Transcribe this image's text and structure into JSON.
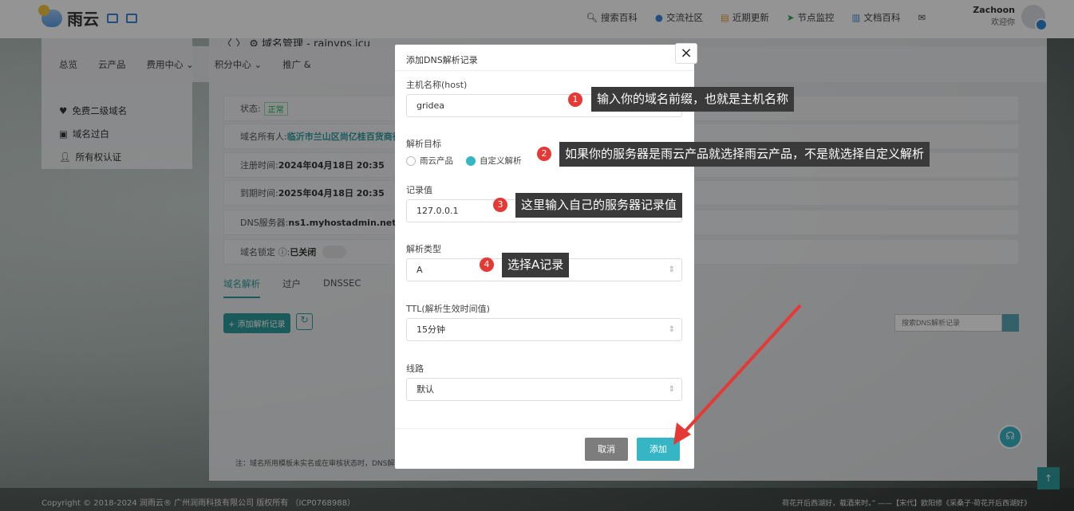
{
  "brand": {
    "name": "雨云"
  },
  "nav": [
    {
      "label": "搜索百科",
      "icon": "search-icon"
    },
    {
      "label": "交流社区",
      "icon": "community-icon"
    },
    {
      "label": "近期更新",
      "icon": "news-icon"
    },
    {
      "label": "节点监控",
      "icon": "monitor-icon"
    },
    {
      "label": "文档百科",
      "icon": "docs-icon"
    }
  ],
  "user": {
    "name": "Zachoon",
    "greeting": "欢迎你"
  },
  "menu": [
    "总览",
    "云产品",
    "费用中心 ⌄",
    "积分中心 ⌄",
    "推广 &"
  ],
  "sidebar": [
    "免费二级域名",
    "域名过白",
    "所有权认证"
  ],
  "page": {
    "title": "〈 〉 ⚙ 域名管理 - rainyps.icu"
  },
  "details": {
    "status_label": "状态:",
    "status_value": "正常",
    "owner_label": "域名所有人:",
    "owner_value": "临沂市兰山区尚亿桂百货商行",
    "reg_label": "注册时间:",
    "reg_value": "2024年04月18日 20:35",
    "exp_label": "到期时间:",
    "exp_value": "2025年04月18日 20:35",
    "dns_label": "DNS服务器:",
    "dns_value": "ns1.myhostadmin.net, n",
    "lock_label": "域名锁定 ⓘ:",
    "lock_value": "已关闭"
  },
  "tabs": [
    "域名解析",
    "过户",
    "DNSSEC"
  ],
  "actions": {
    "add_record": "+ 添加解析记录",
    "search_placeholder": "搜索DNS解析记录"
  },
  "note": "注：域名所用模板未实名或在审核状态时，DNS解",
  "footer": {
    "copyright": "Copyright © 2018-2024 润雨云® 广州润雨科技有限公司 版权所有 （ICP0768988）",
    "quote": "荷花开后西湖好，载酒来时。” ——【宋代】欧阳修《采桑子·荷花开后西湖好》"
  },
  "modal": {
    "title": "添加DNS解析记录",
    "host_label": "主机名称(host)",
    "host_value": "gridea",
    "target_label": "解析目标",
    "target_opt1": "雨云产品",
    "target_opt2": "自定义解析",
    "record_label": "记录值",
    "record_value": "127.0.0.1",
    "type_label": "解析类型",
    "type_value": "A",
    "ttl_label": "TTL(解析生效时间值)",
    "ttl_value": "15分钟",
    "line_label": "线路",
    "line_value": "默认",
    "cancel": "取消",
    "add": "添加"
  },
  "annotations": [
    {
      "num": "1",
      "text": "输入你的域名前缀，也就是主机名称"
    },
    {
      "num": "2",
      "text": "如果你的服务器是雨云产品就选择雨云产品，不是就选择自定义解析"
    },
    {
      "num": "3",
      "text": "这里输入自己的服务器记录值"
    },
    {
      "num": "4",
      "text": "选择A记录"
    }
  ],
  "colors": {
    "accent": "#36b6c4",
    "annotation_red": "#e53935",
    "tip_bg": "#3a3a3a"
  }
}
